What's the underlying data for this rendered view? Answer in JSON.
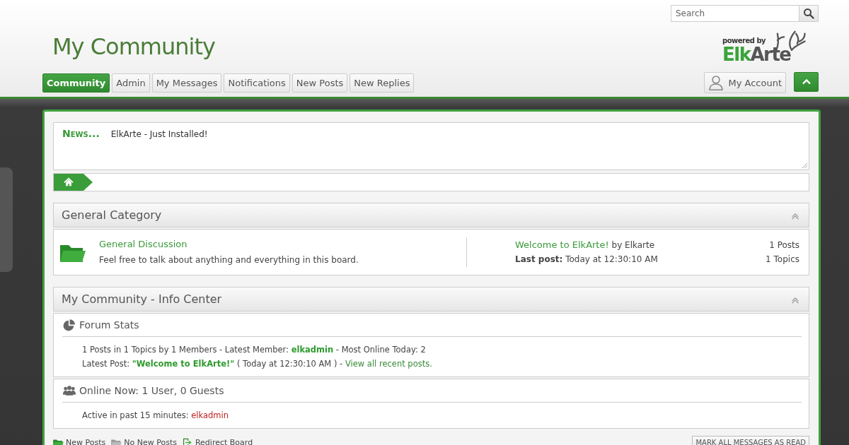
{
  "search": {
    "placeholder": "Search"
  },
  "site_title": "My Community",
  "logo": {
    "tagline": "powered by",
    "word_a": "Elk",
    "word_b": "Arte"
  },
  "nav_tabs": [
    {
      "label": "Community",
      "selected": true
    },
    {
      "label": "Admin",
      "selected": false
    },
    {
      "label": "My Messages",
      "selected": false
    },
    {
      "label": "Notifications",
      "selected": false
    },
    {
      "label": "New Posts",
      "selected": false
    },
    {
      "label": "New Replies",
      "selected": false
    }
  ],
  "account_button": "My Account",
  "news": {
    "label": "News...",
    "text": "ElkArte - Just Installed!"
  },
  "categories": [
    {
      "title": "General Category",
      "boards": [
        {
          "name": "General Discussion",
          "description": "Feel free to talk about anything and everything in this board.",
          "last_topic": "Welcome to ElkArte!",
          "by": "by Elkarte",
          "last_post_label": "Last post:",
          "last_post_time": "Today at 12:30:10 AM",
          "posts": "1 Posts",
          "topics": "1 Topics"
        }
      ]
    }
  ],
  "info_center": {
    "title": "My Community - Info Center",
    "sections": [
      {
        "kind": "stats",
        "title": "Forum Stats",
        "lines": [
          [
            {
              "kind": "plain",
              "text": "1 Posts in 1 Topics by 1 Members - Latest Member: "
            },
            {
              "kind": "member",
              "text": "elkadmin"
            },
            {
              "kind": "plain",
              "text": " - Most Online Today: 2"
            }
          ],
          [
            {
              "kind": "plain",
              "text": "Latest Post: "
            },
            {
              "kind": "topic",
              "text": "\"Welcome to ElkArte!\""
            },
            {
              "kind": "plain",
              "text": " ( Today at 12:30:10 AM ) - "
            },
            {
              "kind": "link",
              "text": "View all recent posts."
            }
          ]
        ]
      },
      {
        "kind": "online",
        "title": "Online Now: 1 User, 0 Guests",
        "lines": [
          [
            {
              "kind": "plain",
              "text": "Active in past 15 minutes: "
            },
            {
              "kind": "admin",
              "text": "elkadmin"
            }
          ]
        ]
      }
    ]
  },
  "legend": [
    {
      "kind": "new",
      "label": "New Posts"
    },
    {
      "kind": "none",
      "label": "No New Posts"
    },
    {
      "kind": "redirect",
      "label": "Redirect Board"
    }
  ],
  "mark_read_button": "MARK ALL MESSAGES AS READ"
}
